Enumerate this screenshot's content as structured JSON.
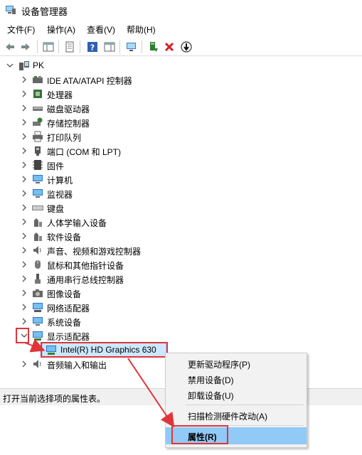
{
  "window": {
    "title": "设备管理器"
  },
  "menu": {
    "file": "文件(F)",
    "action": "操作(A)",
    "view": "查看(V)",
    "help": "帮助(H)"
  },
  "tree": {
    "root": "PK",
    "categories": [
      "IDE ATA/ATAPI 控制器",
      "处理器",
      "磁盘驱动器",
      "存储控制器",
      "打印队列",
      "端口 (COM 和 LPT)",
      "固件",
      "计算机",
      "监视器",
      "键盘",
      "人体学输入设备",
      "软件设备",
      "声音、视频和游戏控制器",
      "鼠标和其他指针设备",
      "通用串行总线控制器",
      "图像设备",
      "网络适配器",
      "系统设备",
      "显示适配器"
    ],
    "display_child": "Intel(R) HD Graphics 630",
    "after": "音频输入和输出"
  },
  "context_menu": {
    "update": "更新驱动程序(P)",
    "disable": "禁用设备(D)",
    "uninstall": "卸载设备(U)",
    "scan": "扫描检测硬件改动(A)",
    "properties": "属性(R)"
  },
  "status": {
    "text": "打开当前选择项的属性表。"
  },
  "colors": {
    "highlight_red": "#e03438",
    "selection": "#91c9f7",
    "tree_selection": "#cce8ff"
  }
}
